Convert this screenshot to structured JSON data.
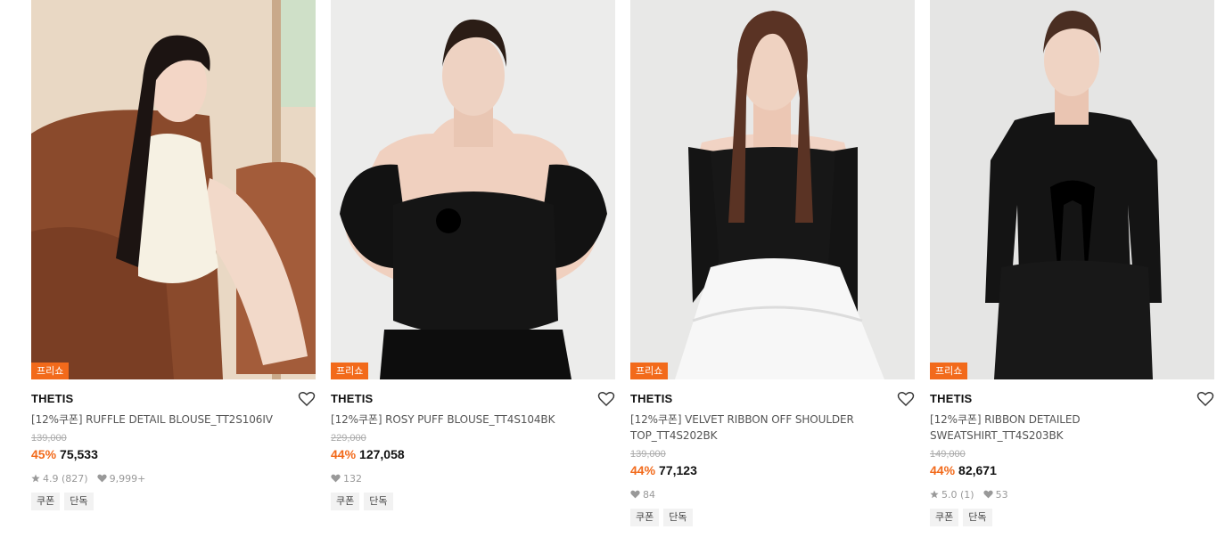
{
  "products": [
    {
      "badge": "프리쇼",
      "brand": "THETIS",
      "title": "[12%쿠폰] RUFFLE DETAIL BLOUSE_TT2S106IV",
      "original_price": "139,000",
      "discount": "45%",
      "price": "75,533",
      "rating": "4.9",
      "reviews": "(827)",
      "likes": "9,999+",
      "tags": [
        "쿠폰",
        "단독"
      ]
    },
    {
      "badge": "프리쇼",
      "brand": "THETIS",
      "title": "[12%쿠폰] ROSY PUFF BLOUSE_TT4S104BK",
      "original_price": "229,000",
      "discount": "44%",
      "price": "127,058",
      "likes": "132",
      "tags": [
        "쿠폰",
        "단독"
      ]
    },
    {
      "badge": "프리쇼",
      "brand": "THETIS",
      "title": "[12%쿠폰] VELVET RIBBON OFF SHOULDER TOP_TT4S202BK",
      "original_price": "139,000",
      "discount": "44%",
      "price": "77,123",
      "likes": "84",
      "tags": [
        "쿠폰",
        "단독"
      ]
    },
    {
      "badge": "프리쇼",
      "brand": "THETIS",
      "title": "[12%쿠폰] RIBBON DETAILED SWEATSHIRT_TT4S203BK",
      "original_price": "149,000",
      "discount": "44%",
      "price": "82,671",
      "rating": "5.0",
      "reviews": "(1)",
      "likes": "53",
      "tags": [
        "쿠폰",
        "단독"
      ]
    }
  ],
  "colors": {
    "accent": "#f26a1b",
    "tag_bg": "#f2f2f2",
    "strike": "#aaaaaa"
  }
}
